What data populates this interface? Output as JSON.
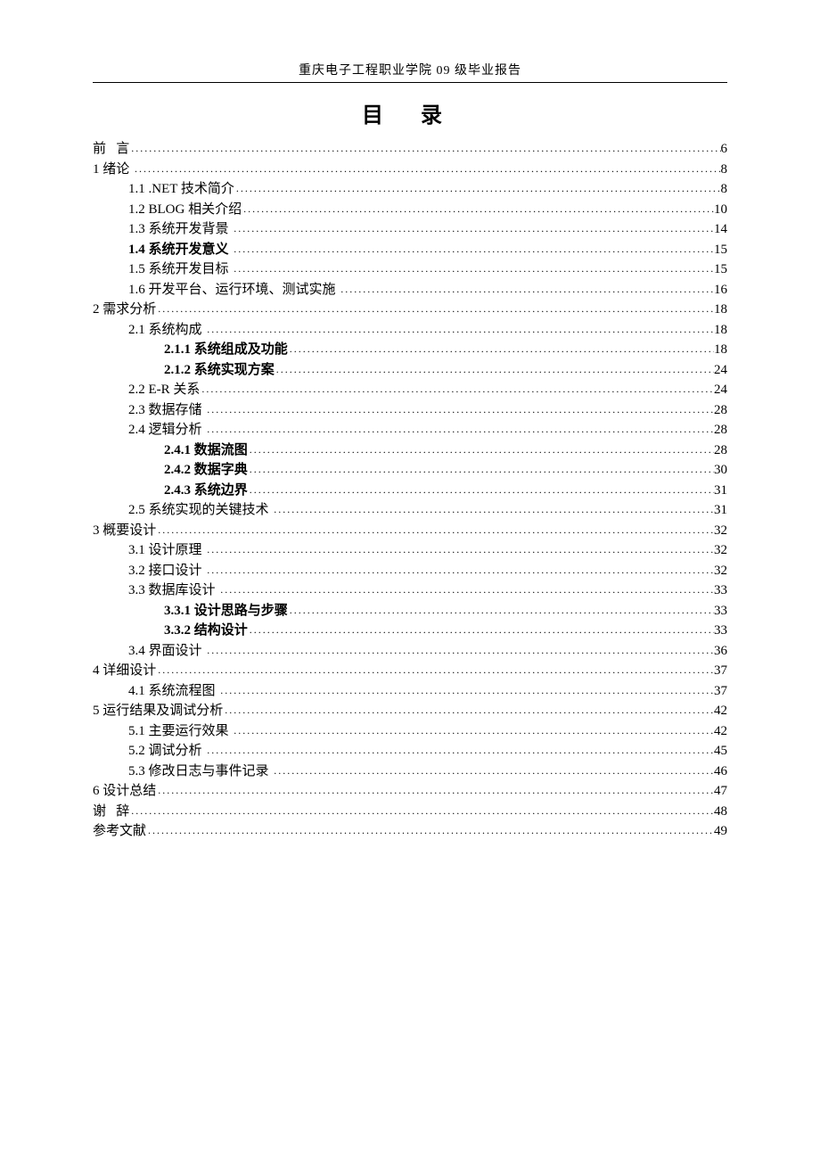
{
  "header": "重庆电子工程职业学院 09 级毕业报告",
  "title": "目 录",
  "toc": [
    {
      "level": 0,
      "label": "前   言",
      "page": "6",
      "spaced": false,
      "bold": false
    },
    {
      "level": 0,
      "label": "1 绪论 ",
      "page": "8",
      "spaced": false,
      "bold": false
    },
    {
      "level": 1,
      "label": "1.1 .NET 技术简介",
      "page": "8",
      "spaced": false,
      "bold": false
    },
    {
      "level": 1,
      "label": "1.2 BLOG 相关介绍",
      "page": "10",
      "spaced": false,
      "bold": false
    },
    {
      "level": 1,
      "label": "1.3 系统开发背景 ",
      "page": "14",
      "spaced": false,
      "bold": false
    },
    {
      "level": 1,
      "label": "1.4 系统开发意义 ",
      "page": "15",
      "spaced": false,
      "bold": true
    },
    {
      "level": 1,
      "label": "1.5 系统开发目标 ",
      "page": "15",
      "spaced": false,
      "bold": false
    },
    {
      "level": 1,
      "label": "1.6 开发平台、运行环境、测试实施 ",
      "page": "16",
      "spaced": false,
      "bold": false
    },
    {
      "level": 0,
      "label": "2 需求分析",
      "page": "18",
      "spaced": false,
      "bold": false
    },
    {
      "level": 1,
      "label": "2.1 系统构成 ",
      "page": "18",
      "spaced": false,
      "bold": false
    },
    {
      "level": 2,
      "label": "2.1.1 系统组成及功能",
      "page": "18",
      "spaced": false,
      "bold": true
    },
    {
      "level": 2,
      "label": "2.1.2 系统实现方案",
      "page": "24",
      "spaced": false,
      "bold": true
    },
    {
      "level": 1,
      "label": "2.2 E-R 关系",
      "page": "24",
      "spaced": false,
      "bold": false
    },
    {
      "level": 1,
      "label": "2.3 数据存储 ",
      "page": "28",
      "spaced": false,
      "bold": false
    },
    {
      "level": 1,
      "label": "2.4 逻辑分析 ",
      "page": "28",
      "spaced": false,
      "bold": false
    },
    {
      "level": 2,
      "label": "2.4.1 数据流图",
      "page": "28",
      "spaced": false,
      "bold": true
    },
    {
      "level": 2,
      "label": "2.4.2 数据字典",
      "page": "30",
      "spaced": false,
      "bold": true
    },
    {
      "level": 2,
      "label": "2.4.3 系统边界",
      "page": "31",
      "spaced": false,
      "bold": true
    },
    {
      "level": 1,
      "label": "2.5 系统实现的关键技术 ",
      "page": "31",
      "spaced": false,
      "bold": false
    },
    {
      "level": 0,
      "label": "3 概要设计",
      "page": "32",
      "spaced": false,
      "bold": false
    },
    {
      "level": 1,
      "label": "3.1 设计原理 ",
      "page": "32",
      "spaced": false,
      "bold": false
    },
    {
      "level": 1,
      "label": "3.2 接口设计 ",
      "page": "32",
      "spaced": false,
      "bold": false
    },
    {
      "level": 1,
      "label": "3.3 数据库设计 ",
      "page": "33",
      "spaced": false,
      "bold": false
    },
    {
      "level": 2,
      "label": "3.3.1 设计思路与步骤",
      "page": "33",
      "spaced": false,
      "bold": true
    },
    {
      "level": 2,
      "label": "3.3.2 结构设计",
      "page": "33",
      "spaced": false,
      "bold": true
    },
    {
      "level": 1,
      "label": "3.4 界面设计 ",
      "page": "36",
      "spaced": false,
      "bold": false
    },
    {
      "level": 0,
      "label": "4 详细设计",
      "page": "37",
      "spaced": false,
      "bold": false
    },
    {
      "level": 1,
      "label": "4.1 系统流程图 ",
      "page": "37",
      "spaced": false,
      "bold": false
    },
    {
      "level": 0,
      "label": "5 运行结果及调试分析",
      "page": "42",
      "spaced": false,
      "bold": false
    },
    {
      "level": 1,
      "label": "5.1 主要运行效果 ",
      "page": "42",
      "spaced": false,
      "bold": false
    },
    {
      "level": 1,
      "label": "5.2 调试分析 ",
      "page": "45",
      "spaced": false,
      "bold": false
    },
    {
      "level": 1,
      "label": "5.3 修改日志与事件记录 ",
      "page": "46",
      "spaced": false,
      "bold": false
    },
    {
      "level": 0,
      "label": "6 设计总结",
      "page": "47",
      "spaced": false,
      "bold": false
    },
    {
      "level": 0,
      "label": "谢   辞",
      "page": "48",
      "spaced": false,
      "bold": false
    },
    {
      "level": 0,
      "label": "参考文献",
      "page": "49",
      "spaced": false,
      "bold": false
    }
  ]
}
